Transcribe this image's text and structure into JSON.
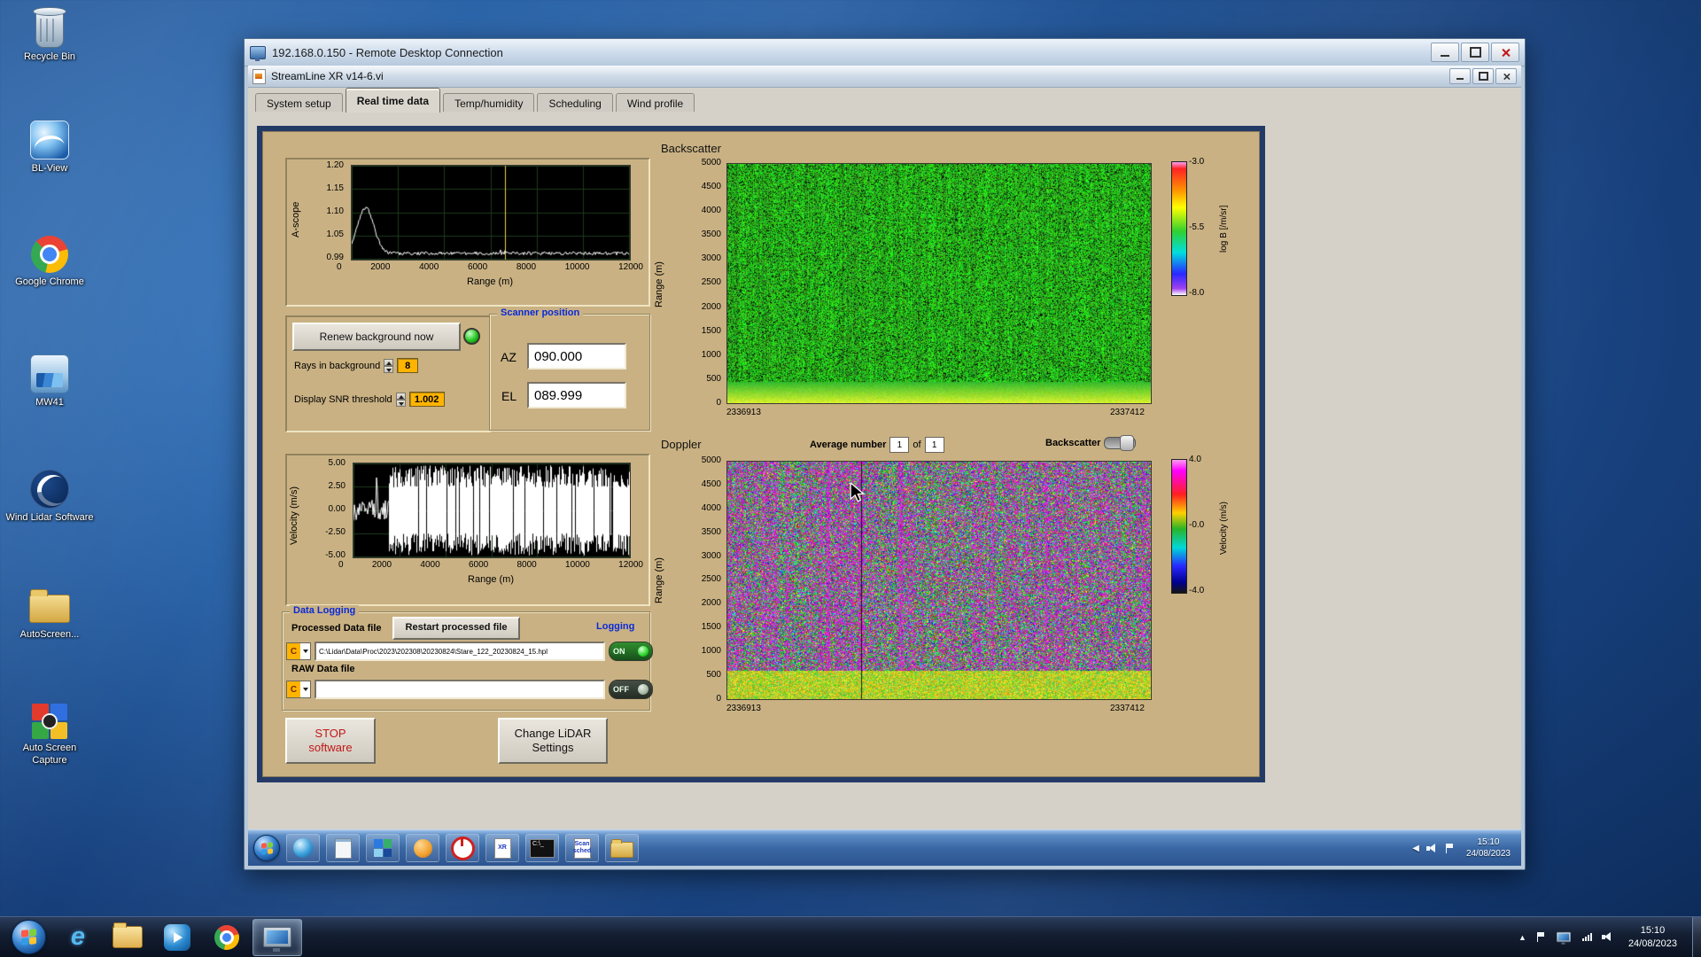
{
  "desktop": {
    "icons": [
      {
        "label": "Recycle Bin"
      },
      {
        "label": "BL-View"
      },
      {
        "label": "Google Chrome"
      },
      {
        "label": "MW41"
      },
      {
        "label": "Wind Lidar Software"
      },
      {
        "label": "AutoScreen..."
      },
      {
        "label": "Auto Screen Capture"
      }
    ]
  },
  "rdp_window": {
    "title": "192.168.0.150 - Remote Desktop Connection"
  },
  "app_window": {
    "title": "StreamLine XR v14-6.vi",
    "tabs": [
      "System setup",
      "Real time data",
      "Temp/humidity",
      "Scheduling",
      "Wind profile"
    ],
    "active_tab": "Real time data"
  },
  "controls": {
    "renew_button": "Renew background now",
    "rays_label": "Rays in background",
    "rays_value": "8",
    "snr_label": "Display SNR threshold",
    "snr_value": "1.002",
    "scanner_group": "Scanner position",
    "az_label": "AZ",
    "az_value": "090.000",
    "el_label": "EL",
    "el_value": "089.999",
    "average_label": "Average number",
    "average_value": "1",
    "of_label": "of",
    "of_value": "1",
    "backscatter_toggle_label": "Backscatter",
    "stop_line1": "STOP",
    "stop_line2": "software",
    "change_line1": "Change LiDAR",
    "change_line2": "Settings"
  },
  "data_logging": {
    "group_title": "Data Logging",
    "processed_label": "Processed Data file",
    "restart_button": "Restart processed file",
    "logging_label": "Logging",
    "drive": "C",
    "processed_path": "C:\\Lidar\\Data\\Proc\\2023\\202308\\20230824\\Stare_122_20230824_15.hpl",
    "on_label": "ON",
    "raw_label": "RAW Data file",
    "raw_path": "",
    "off_label": "OFF"
  },
  "remote_taskbar": {
    "time": "15:10",
    "date": "24/08/2023",
    "icons": [
      "network-globe",
      "notepad",
      "remote-tiles",
      "paint",
      "power",
      "xr-doc",
      "terminal",
      "scan-sched",
      "folder"
    ],
    "xr_glyph": "XR",
    "scan_glyph": "Scan sched",
    "cmd_glyph": "C:\\_"
  },
  "host_taskbar": {
    "time": "15:10",
    "date": "24/08/2023",
    "icons": [
      "internet-explorer",
      "windows-explorer",
      "media-player",
      "chrome",
      "remote-desktop"
    ]
  },
  "colors": {
    "panel_tan": "#c9b183",
    "panel_frame": "#243a66",
    "led_on": "#22c822",
    "numeric_field": "#ffb400",
    "group_title_blue": "#0a2ad8",
    "toggle_on_green": "#2f8f2f",
    "stop_text_red": "#c01818"
  },
  "chart_data": [
    {
      "id": "a_scope",
      "type": "line",
      "xlabel": "Range (m)",
      "ylabel": "A-scope",
      "x_ticks": [
        "0",
        "2000",
        "4000",
        "6000",
        "8000",
        "10000",
        "12000"
      ],
      "y_ticks": [
        "1.20",
        "1.15",
        "1.10",
        "1.05",
        "0.99"
      ],
      "xlim": [
        0,
        12000
      ],
      "ylim": [
        0.99,
        1.2
      ],
      "bg": "#000000",
      "grid": "#1d3a1d",
      "series": [
        {
          "name": "background a-scope",
          "color": "#ffffff"
        }
      ],
      "gen": {
        "baseline": 1.004,
        "peak_x": 600,
        "peak_w": 500,
        "peak_amp": 0.102,
        "noise": 0.0035,
        "cursor_x": 6600,
        "cursor_color": "#e8d44a"
      }
    },
    {
      "id": "backscatter",
      "type": "heatmap",
      "title": "Backscatter",
      "ylabel": "Range (m)",
      "y_ticks": [
        "5000",
        "4500",
        "4000",
        "3500",
        "3000",
        "2500",
        "2000",
        "1500",
        "1000",
        "500",
        "0"
      ],
      "x_start_label": "2336913",
      "x_end_label": "2337412",
      "colorbar": {
        "label": "log B [/m/sr]",
        "ticks": [
          "-3.0",
          "-5.5",
          "-8.0"
        ],
        "range": [
          -3.0,
          -8.0
        ],
        "stops": [
          "#ff9cf0 0%",
          "#ff2222 5%",
          "#ff9800 22%",
          "#ffff00 34%",
          "#30d030 52%",
          "#00dede 68%",
          "#2828ff 84%",
          "#a040f0 95%",
          "#ffffff 100%"
        ]
      },
      "pattern": {
        "base": "green-noise",
        "dark_speckle": 0.13,
        "surface_band_frac": 0.09
      }
    },
    {
      "id": "velocity_scope",
      "type": "line",
      "xlabel": "Range (m)",
      "ylabel": "Velocity (m/s)",
      "x_ticks": [
        "0",
        "2000",
        "4000",
        "6000",
        "8000",
        "10000",
        "12000"
      ],
      "y_ticks": [
        "5.00",
        "2.50",
        "0.00",
        "-2.50",
        "-5.00"
      ],
      "xlim": [
        0,
        12000
      ],
      "ylim": [
        -5,
        5
      ],
      "bg": "#000000",
      "grid": "#1d3a1d",
      "series": [
        {
          "name": "velocity",
          "color": "#ffffff"
        }
      ],
      "gen": {
        "coherent_frac": 0.13,
        "noise_amp": 5
      }
    },
    {
      "id": "doppler",
      "type": "heatmap",
      "title": "Doppler",
      "ylabel": "Range (m)",
      "y_ticks": [
        "5000",
        "4500",
        "4000",
        "3500",
        "3000",
        "2500",
        "2000",
        "1500",
        "1000",
        "500",
        "0"
      ],
      "x_start_label": "2336913",
      "x_end_label": "2337412",
      "colorbar": {
        "label": "Velocity (m/s)",
        "ticks": [
          "4.0",
          "-0.0",
          "-4.0"
        ],
        "range": [
          4,
          -4
        ],
        "stops": [
          "#ff9cf0 0%",
          "#ff00ff 8%",
          "#ff2020 26%",
          "#ffd000 40%",
          "#28b428 52%",
          "#00d8d8 66%",
          "#2828ff 80%",
          "#000090 92%",
          "#141414 100%"
        ]
      },
      "pattern": {
        "base": "velocity-noise",
        "streak_prob": 0.5,
        "surface_band_frac": 0.12,
        "cursor_col_frac": 0.315
      }
    }
  ]
}
